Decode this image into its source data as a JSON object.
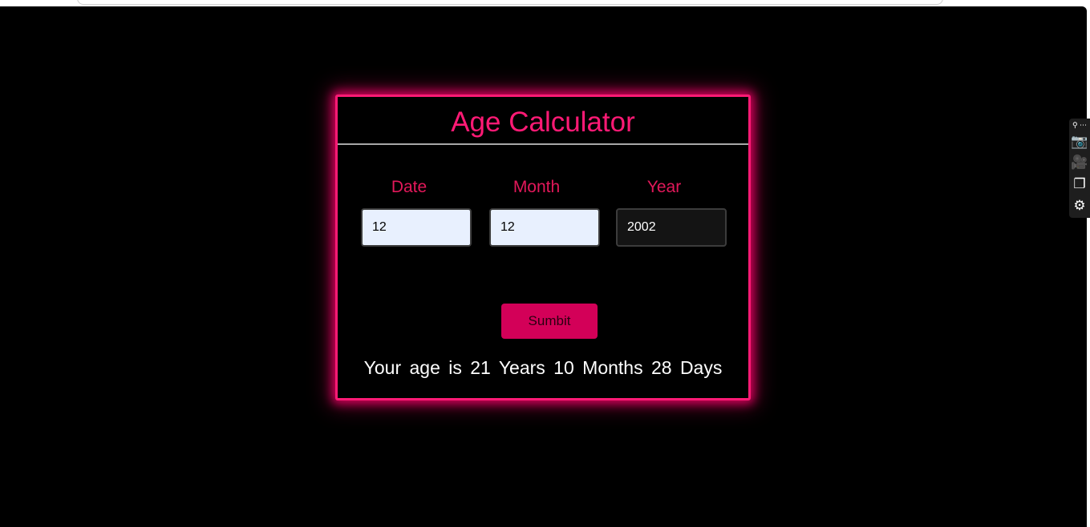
{
  "app": {
    "title": "Age Calculator"
  },
  "form": {
    "date_label": "Date",
    "month_label": "Month",
    "year_label": "Year",
    "date_value": "12",
    "month_value": "12",
    "year_value": "2002",
    "submit_label": "Sumbit"
  },
  "result": {
    "text": "Your age is 21 Years 10 Months 28 Days"
  },
  "toolbar": {
    "items": [
      {
        "icon": "link-more-icon",
        "glyph": "⚲ ⋯"
      },
      {
        "icon": "camera-icon",
        "glyph": "📷"
      },
      {
        "icon": "video-camera-icon",
        "glyph": "🎥"
      },
      {
        "icon": "windows-icon",
        "glyph": "❐"
      },
      {
        "icon": "gear-icon",
        "glyph": "⚙"
      }
    ]
  },
  "colors": {
    "accent": "#ff1a75",
    "label": "#e2185a",
    "button": "#d30058",
    "background": "#000000",
    "result_text": "#ffffff"
  }
}
